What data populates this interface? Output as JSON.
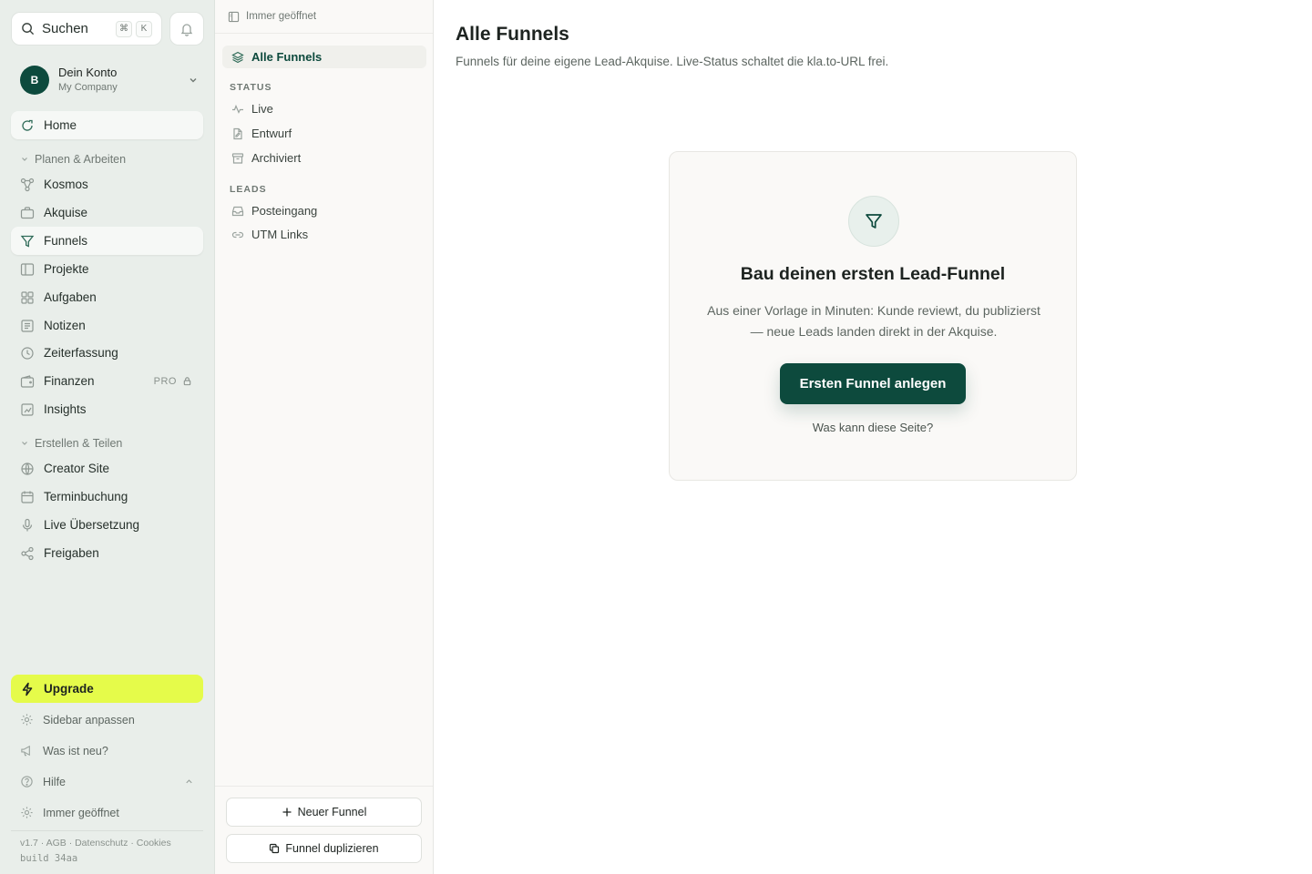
{
  "search": {
    "label": "Suchen",
    "kbd_mod": "⌘",
    "kbd_key": "K"
  },
  "account": {
    "initial": "B",
    "name": "Dein Konto",
    "company": "My Company"
  },
  "nav": {
    "home": "Home",
    "group1": "Planen & Arbeiten",
    "group1_items": [
      "Kosmos",
      "Akquise",
      "Funnels",
      "Projekte",
      "Aufgaben",
      "Notizen",
      "Zeiterfassung",
      "Finanzen",
      "Insights"
    ],
    "pro_badge": "PRO",
    "group2": "Erstellen & Teilen",
    "group2_items": [
      "Creator Site",
      "Terminbuchung",
      "Live Übersetzung",
      "Freigaben"
    ]
  },
  "sidebar_footer": {
    "upgrade": "Upgrade",
    "customize": "Sidebar anpassen",
    "whats_new": "Was ist neu?",
    "help": "Hilfe",
    "always_open": "Immer geöffnet",
    "legal": "v1.7 · AGB · Datenschutz · Cookies",
    "build": "build 34aa"
  },
  "panel": {
    "header": "Immer geöffnet",
    "all": "Alle Funnels",
    "status_head": "STATUS",
    "status_items": [
      "Live",
      "Entwurf",
      "Archiviert"
    ],
    "leads_head": "LEADS",
    "leads_items": [
      "Posteingang",
      "UTM Links"
    ],
    "new_button": "Neuer Funnel",
    "duplicate_button": "Funnel duplizieren"
  },
  "main": {
    "title": "Alle Funnels",
    "subtitle": "Funnels für deine eigene Lead-Akquise. Live-Status schaltet die kla.to-URL frei.",
    "empty": {
      "title": "Bau deinen ersten Lead-Funnel",
      "desc_line1": "Aus einer Vorlage in Minuten: Kunde reviewt, du publizierst",
      "desc_line2": "— neue Leads landen direkt in der Akquise.",
      "cta": "Ersten Funnel anlegen",
      "link": "Was kann diese Seite?"
    }
  },
  "colors": {
    "accent": "#0d4a3d",
    "upgrade": "#e5fb4a",
    "sidebar_bg": "#e9eeea",
    "panel_bg": "#faf9f7"
  }
}
